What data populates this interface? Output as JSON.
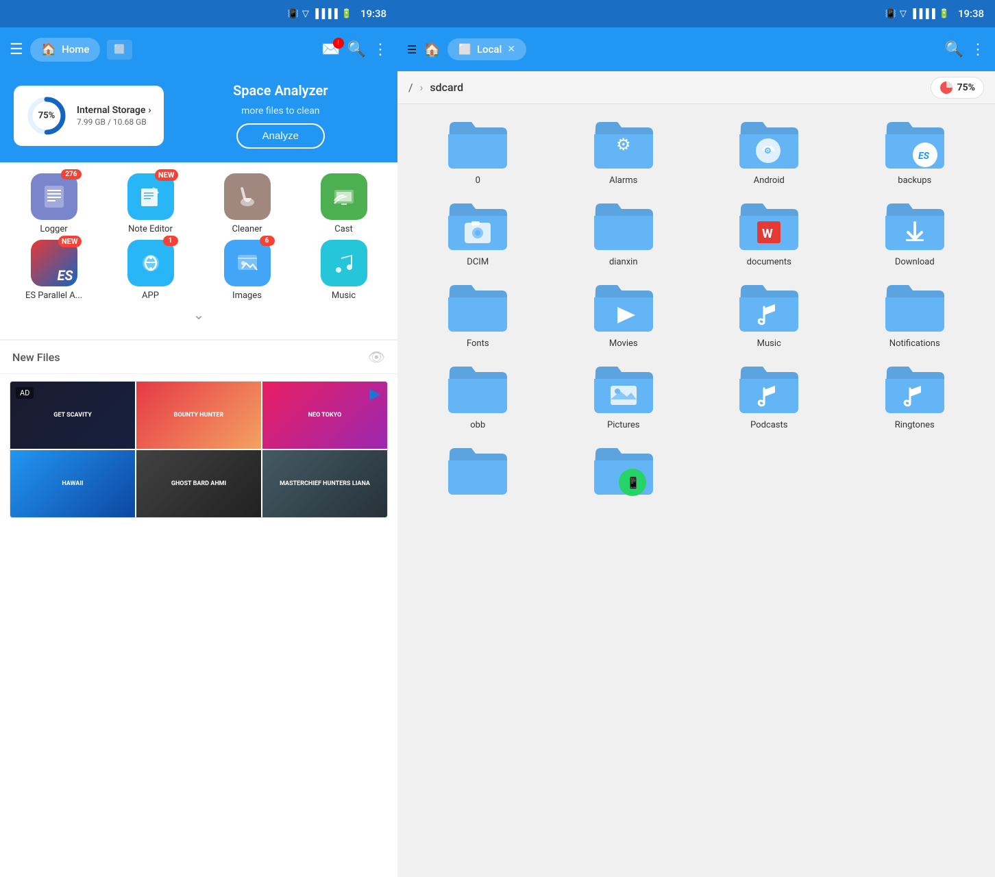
{
  "left": {
    "statusBar": {
      "time": "19:38"
    },
    "navBar": {
      "homeLabel": "Home",
      "tabLabel": "□"
    },
    "spaceAnalyzer": {
      "title": "Space Analyzer",
      "subtitle": "more files to clean",
      "analyzeBtn": "Analyze",
      "storageTitle": "Internal Storage",
      "storageSize": "7.99 GB / 10.68 GB",
      "storagePercent": "75%",
      "chevron": "›"
    },
    "apps": [
      {
        "id": "logger",
        "label": "Logger",
        "badge": "276",
        "badgeType": "num",
        "iconClass": "icon-logger",
        "icon": "📋"
      },
      {
        "id": "noteeditor",
        "label": "Note Editor",
        "badge": "NEW",
        "badgeType": "new",
        "iconClass": "icon-noteeditor",
        "icon": "✏️"
      },
      {
        "id": "cleaner",
        "label": "Cleaner",
        "badge": "",
        "badgeType": "",
        "iconClass": "icon-cleaner",
        "icon": "🧹"
      },
      {
        "id": "cast",
        "label": "Cast",
        "badge": "",
        "badgeType": "",
        "iconClass": "icon-cast",
        "icon": "🖥"
      },
      {
        "id": "esparallel",
        "label": "ES Parallel A...",
        "badge": "NEW",
        "badgeType": "new",
        "iconClass": "icon-esparallel",
        "icon": "⚡"
      },
      {
        "id": "app",
        "label": "APP",
        "badge": "1",
        "badgeType": "num",
        "iconClass": "icon-app",
        "icon": "🤖"
      },
      {
        "id": "images",
        "label": "Images",
        "badge": "6",
        "badgeType": "num",
        "iconClass": "icon-images",
        "icon": "🖼"
      },
      {
        "id": "music",
        "label": "Music",
        "badge": "",
        "badgeType": "",
        "iconClass": "icon-music",
        "icon": "🎵"
      }
    ],
    "newFiles": {
      "title": "New Files",
      "adLabel": "AD"
    }
  },
  "right": {
    "statusBar": {
      "time": "19:38"
    },
    "navBar": {
      "localLabel": "Local"
    },
    "breadcrumb": {
      "root": "/",
      "arrow": "›",
      "current": "sdcard",
      "storagePercent": "75%"
    },
    "folders": [
      {
        "id": "folder-0",
        "label": "0",
        "overlayIcon": ""
      },
      {
        "id": "folder-alarms",
        "label": "Alarms",
        "overlayIcon": "⚙"
      },
      {
        "id": "folder-android",
        "label": "Android",
        "overlayIcon": "⚙"
      },
      {
        "id": "folder-backups",
        "label": "backups",
        "overlayIcon": "ES"
      },
      {
        "id": "folder-dcim",
        "label": "DCIM",
        "overlayIcon": "📷"
      },
      {
        "id": "folder-dianxin",
        "label": "dianxin",
        "overlayIcon": ""
      },
      {
        "id": "folder-documents",
        "label": "documents",
        "overlayIcon": "W"
      },
      {
        "id": "folder-download",
        "label": "Download",
        "overlayIcon": "⬇"
      },
      {
        "id": "folder-fonts",
        "label": "Fonts",
        "overlayIcon": ""
      },
      {
        "id": "folder-movies",
        "label": "Movies",
        "overlayIcon": "▶"
      },
      {
        "id": "folder-music",
        "label": "Music",
        "overlayIcon": "♪"
      },
      {
        "id": "folder-notifications",
        "label": "Notifications",
        "overlayIcon": ""
      },
      {
        "id": "folder-obb",
        "label": "obb",
        "overlayIcon": ""
      },
      {
        "id": "folder-pictures",
        "label": "Pictures",
        "overlayIcon": "🖼"
      },
      {
        "id": "folder-podcasts",
        "label": "Podcasts",
        "overlayIcon": "♪"
      },
      {
        "id": "folder-ringtones",
        "label": "Ringtones",
        "overlayIcon": "♪"
      },
      {
        "id": "folder-extra1",
        "label": "",
        "overlayIcon": ""
      },
      {
        "id": "folder-extra2",
        "label": "",
        "overlayIcon": "whatsapp"
      }
    ]
  }
}
